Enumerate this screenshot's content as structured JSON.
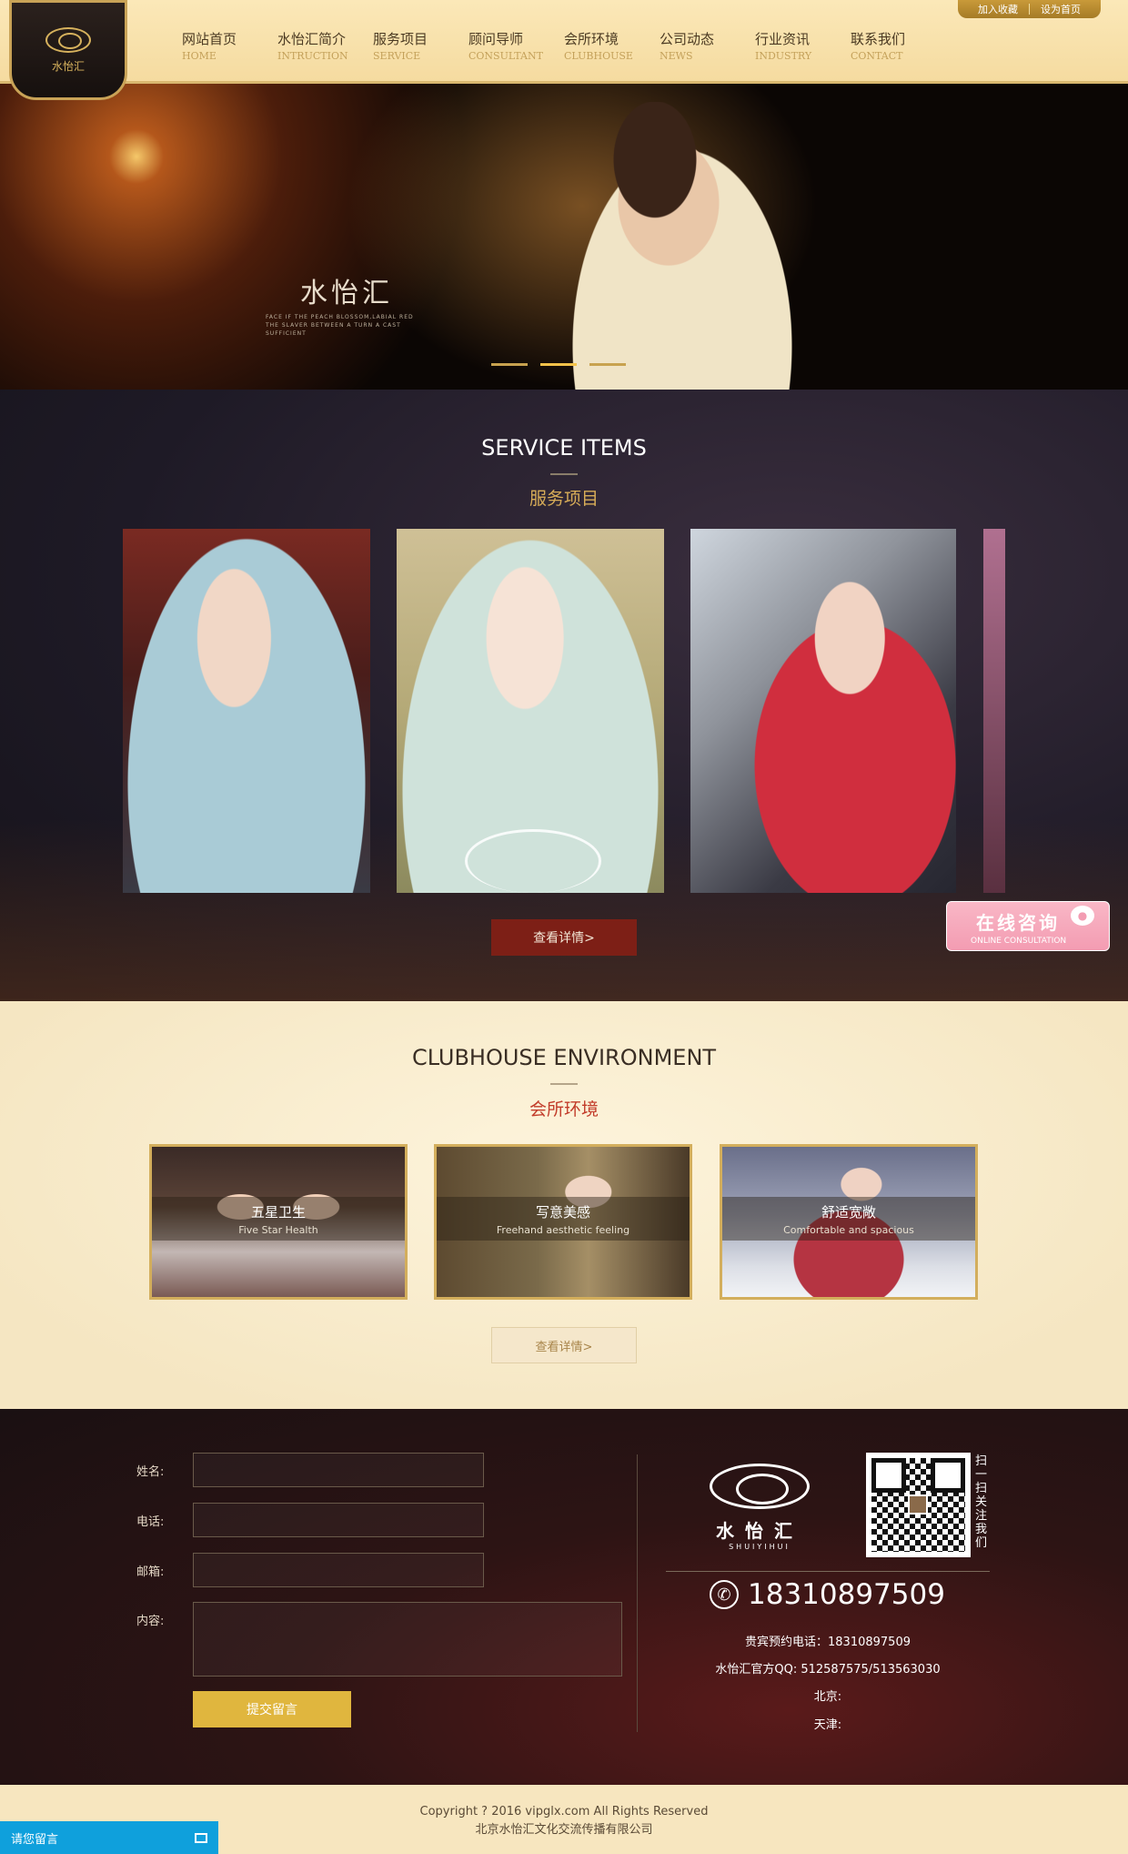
{
  "header": {
    "logo_text": "水怡汇",
    "top_links": [
      "加入收藏",
      "设为首页"
    ],
    "nav": [
      {
        "cn": "网站首页",
        "en": "HOME"
      },
      {
        "cn": "水怡汇简介",
        "en": "INTRUCTION"
      },
      {
        "cn": "服务项目",
        "en": "SERVICE"
      },
      {
        "cn": "顾问导师",
        "en": "CONSULTANT"
      },
      {
        "cn": "会所环境",
        "en": "CLUBHOUSE"
      },
      {
        "cn": "公司动态",
        "en": "NEWS"
      },
      {
        "cn": "行业资讯",
        "en": "INDUSTRY"
      },
      {
        "cn": "联系我们",
        "en": "CONTACT"
      }
    ]
  },
  "banner": {
    "title": "水怡汇",
    "subtitle": "FACE IF THE PEACH BLOSSOM,LABIAL RED THE SLAVER BETWEEN A TURN A CAST SUFFICIENT",
    "slides": 3,
    "active_slide": 2
  },
  "services": {
    "title_en": "SERVICE ITEMS",
    "title_cn": "服务项目",
    "more": "查看详情>"
  },
  "consult": {
    "cn": "在线咨询",
    "en": "ONLINE CONSULTATION"
  },
  "club": {
    "title_en": "CLUBHOUSE ENVIRONMENT",
    "title_cn": "会所环境",
    "items": [
      {
        "cn": "五星卫生",
        "en": "Five Star Health"
      },
      {
        "cn": "写意美感",
        "en": "Freehand aesthetic feeling"
      },
      {
        "cn": "舒适宽敞",
        "en": "Comfortable and spacious"
      }
    ],
    "more": "查看详情>"
  },
  "form": {
    "name_label": "姓名:",
    "phone_label": "电话:",
    "email_label": "邮箱:",
    "content_label": "内容:",
    "submit": "提交留言"
  },
  "footer": {
    "logo_name": "水怡汇",
    "logo_en": "SHUIYIHUI",
    "qr_text": "扫一扫关注我们",
    "phone": "18310897509",
    "booking": "贵宾预约电话：18310897509",
    "qq": "水怡汇官方QQ: 512587575/513563030",
    "beijing": "北京:",
    "tianjin": "天津:"
  },
  "copyright": {
    "line1": "Copyright ? 2016 vipglx.com All Rights Reserved",
    "line2": "北京水怡汇文化交流传播有限公司"
  },
  "message_bar": {
    "label": "请您留言"
  }
}
